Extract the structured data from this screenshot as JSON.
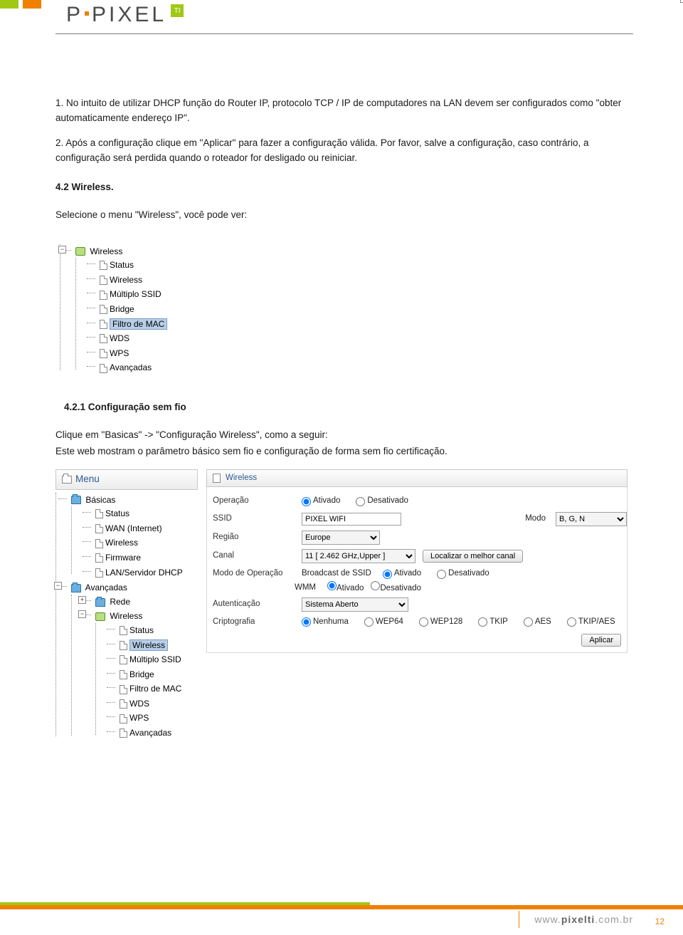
{
  "logo": {
    "text": "PIXEL",
    "badge": "TI"
  },
  "body": {
    "p1": "1. No intuito de utilizar DHCP função do Router IP, protocolo TCP / IP de computadores na LAN devem ser configurados como \"obter automaticamente endereço IP\".",
    "p2": "2. Após a configuração clique em \"Aplicar\" para fazer a configuração válida. Por favor, salve a configuração, caso contrário, a configuração será perdida quando o roteador for desligado ou reiniciar.",
    "h1": "4.2 Wireless.",
    "p3": "Selecione o menu \"Wireless\", você pode ver:",
    "h2": "4.2.1 Configuração sem fio",
    "p4": "Clique em \"Basicas\" -> \"Configuração Wireless\", como a seguir:",
    "p5": "Este web mostram o parâmetro básico sem fio e configuração de forma sem fio certificação."
  },
  "tree1": {
    "root": "Wireless",
    "items": [
      "Status",
      "Wireless",
      "Múltiplo SSID",
      "Bridge",
      "Filtro de MAC",
      "WDS",
      "WPS",
      "Avançadas"
    ],
    "selected": "Filtro de MAC"
  },
  "tree2": {
    "menu_title": "Menu",
    "basicas": {
      "label": "Básicas",
      "items": [
        "Status",
        "WAN (Internet)",
        "Wireless",
        "Firmware",
        "LAN/Servidor DHCP"
      ]
    },
    "avancadas": {
      "label": "Avançadas",
      "rede": "Rede",
      "wireless": {
        "label": "Wireless",
        "items": [
          "Status",
          "Wireless",
          "Múltiplo SSID",
          "Bridge",
          "Filtro de MAC",
          "WDS",
          "WPS",
          "Avançadas"
        ],
        "selected": "Wireless"
      }
    }
  },
  "panel": {
    "title": "Wireless",
    "operacao": {
      "label": "Operação",
      "ativado": "Ativado",
      "desativado": "Desativado"
    },
    "ssid": {
      "label": "SSID",
      "value": "PIXEL WIFI"
    },
    "modo": {
      "label": "Modo",
      "value": "B, G, N"
    },
    "regiao": {
      "label": "Região",
      "value": "Europe"
    },
    "canal": {
      "label": "Canal",
      "value": "11 [ 2.462 GHz,Upper ]",
      "button": "Localizar o melhor canal"
    },
    "modo_op": {
      "label": "Modo de Operação",
      "bcast": "Broadcast de SSID",
      "ativado": "Ativado",
      "desativado": "Desativado"
    },
    "wmm": {
      "label": "WMM",
      "ativado": "Ativado",
      "desativado": "Desativado"
    },
    "auth": {
      "label": "Autenticação",
      "value": "Sistema Aberto"
    },
    "cripto": {
      "label": "Criptografia",
      "opts": [
        "Nenhuma",
        "WEP64",
        "WEP128",
        "TKIP",
        "AES",
        "TKIP/AES"
      ]
    },
    "apply": "Aplicar"
  },
  "footer": {
    "url_pre": "www.",
    "url_mid": "pixelti",
    "url_suf": ".com.br",
    "page": "12"
  }
}
